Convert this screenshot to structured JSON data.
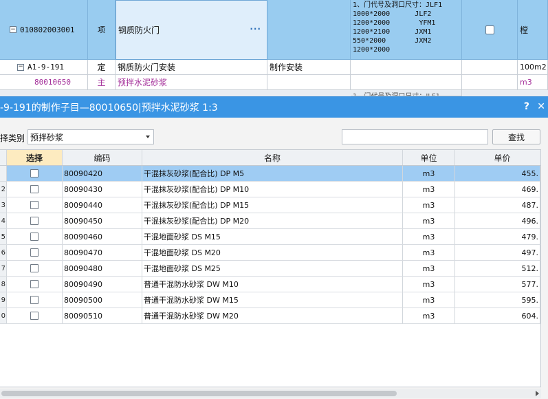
{
  "background_grid": {
    "rows": [
      {
        "code": "010802003001",
        "type": "项",
        "name": "钢质防火门",
        "ellipsis": "···",
        "description_lines": [
          "1、门代号及洞口尺寸：JLF1",
          "1000*2000      JLF2",
          "1200*2000       YFM1",
          "1200*2100      JXM1",
          "550*2000       JXM2",
          "1200*2000"
        ],
        "unit": "樘"
      },
      {
        "code": "A1-9-191",
        "type": "定",
        "name": "钢质防火门安装",
        "content": "制作安装",
        "unit": "100m2"
      },
      {
        "code": "80010650",
        "type": "主",
        "name": "预拌水泥砂浆",
        "unit": "m3"
      }
    ],
    "partial_text": "1、门代号及洞口尺寸：JLF1"
  },
  "dialog": {
    "title": "-9-191的制作子目—80010650|预拌水泥砂浆 1:3",
    "help_label": "?",
    "close_label": "✕",
    "filter_label": "择类别",
    "category_value": "预拌砂浆",
    "search_value": "",
    "search_button": "查找",
    "columns": [
      "选择",
      "编码",
      "名称",
      "单位",
      "单价"
    ],
    "rows": [
      {
        "num": "",
        "code": "80090420",
        "name": "干混抹灰砂浆(配合比) DP M5",
        "unit": "m3",
        "price": "455.",
        "selected": true
      },
      {
        "num": "2",
        "code": "80090430",
        "name": "干混抹灰砂浆(配合比) DP M10",
        "unit": "m3",
        "price": "469."
      },
      {
        "num": "3",
        "code": "80090440",
        "name": "干混抹灰砂浆(配合比) DP M15",
        "unit": "m3",
        "price": "487."
      },
      {
        "num": "4",
        "code": "80090450",
        "name": "干混抹灰砂浆(配合比) DP M20",
        "unit": "m3",
        "price": "496."
      },
      {
        "num": "5",
        "code": "80090460",
        "name": "干混地面砂浆 DS M15",
        "unit": "m3",
        "price": "479."
      },
      {
        "num": "6",
        "code": "80090470",
        "name": "干混地面砂浆 DS M20",
        "unit": "m3",
        "price": "497."
      },
      {
        "num": "7",
        "code": "80090480",
        "name": "干混地面砂浆 DS M25",
        "unit": "m3",
        "price": "512."
      },
      {
        "num": "8",
        "code": "80090490",
        "name": "普通干混防水砂浆 DW M10",
        "unit": "m3",
        "price": "577."
      },
      {
        "num": "9",
        "code": "80090500",
        "name": "普通干混防水砂浆 DW M15",
        "unit": "m3",
        "price": "595."
      },
      {
        "num": "0",
        "code": "80090510",
        "name": "普通干混防水砂浆 DW M20",
        "unit": "m3",
        "price": "604."
      }
    ]
  }
}
